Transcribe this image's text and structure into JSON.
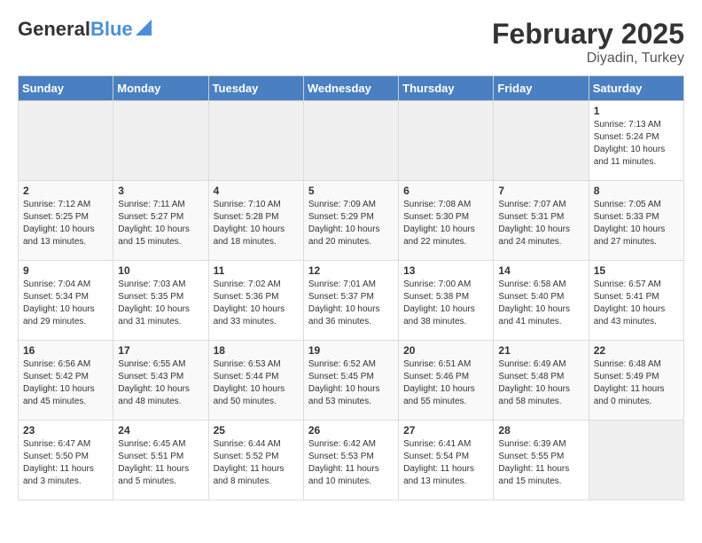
{
  "header": {
    "logo_line1": "General",
    "logo_line2": "Blue",
    "title": "February 2025",
    "subtitle": "Diyadin, Turkey"
  },
  "days_of_week": [
    "Sunday",
    "Monday",
    "Tuesday",
    "Wednesday",
    "Thursday",
    "Friday",
    "Saturday"
  ],
  "weeks": [
    [
      {
        "day": "",
        "info": ""
      },
      {
        "day": "",
        "info": ""
      },
      {
        "day": "",
        "info": ""
      },
      {
        "day": "",
        "info": ""
      },
      {
        "day": "",
        "info": ""
      },
      {
        "day": "",
        "info": ""
      },
      {
        "day": "1",
        "info": "Sunrise: 7:13 AM\nSunset: 5:24 PM\nDaylight: 10 hours\nand 11 minutes."
      }
    ],
    [
      {
        "day": "2",
        "info": "Sunrise: 7:12 AM\nSunset: 5:25 PM\nDaylight: 10 hours\nand 13 minutes."
      },
      {
        "day": "3",
        "info": "Sunrise: 7:11 AM\nSunset: 5:27 PM\nDaylight: 10 hours\nand 15 minutes."
      },
      {
        "day": "4",
        "info": "Sunrise: 7:10 AM\nSunset: 5:28 PM\nDaylight: 10 hours\nand 18 minutes."
      },
      {
        "day": "5",
        "info": "Sunrise: 7:09 AM\nSunset: 5:29 PM\nDaylight: 10 hours\nand 20 minutes."
      },
      {
        "day": "6",
        "info": "Sunrise: 7:08 AM\nSunset: 5:30 PM\nDaylight: 10 hours\nand 22 minutes."
      },
      {
        "day": "7",
        "info": "Sunrise: 7:07 AM\nSunset: 5:31 PM\nDaylight: 10 hours\nand 24 minutes."
      },
      {
        "day": "8",
        "info": "Sunrise: 7:05 AM\nSunset: 5:33 PM\nDaylight: 10 hours\nand 27 minutes."
      }
    ],
    [
      {
        "day": "9",
        "info": "Sunrise: 7:04 AM\nSunset: 5:34 PM\nDaylight: 10 hours\nand 29 minutes."
      },
      {
        "day": "10",
        "info": "Sunrise: 7:03 AM\nSunset: 5:35 PM\nDaylight: 10 hours\nand 31 minutes."
      },
      {
        "day": "11",
        "info": "Sunrise: 7:02 AM\nSunset: 5:36 PM\nDaylight: 10 hours\nand 33 minutes."
      },
      {
        "day": "12",
        "info": "Sunrise: 7:01 AM\nSunset: 5:37 PM\nDaylight: 10 hours\nand 36 minutes."
      },
      {
        "day": "13",
        "info": "Sunrise: 7:00 AM\nSunset: 5:38 PM\nDaylight: 10 hours\nand 38 minutes."
      },
      {
        "day": "14",
        "info": "Sunrise: 6:58 AM\nSunset: 5:40 PM\nDaylight: 10 hours\nand 41 minutes."
      },
      {
        "day": "15",
        "info": "Sunrise: 6:57 AM\nSunset: 5:41 PM\nDaylight: 10 hours\nand 43 minutes."
      }
    ],
    [
      {
        "day": "16",
        "info": "Sunrise: 6:56 AM\nSunset: 5:42 PM\nDaylight: 10 hours\nand 45 minutes."
      },
      {
        "day": "17",
        "info": "Sunrise: 6:55 AM\nSunset: 5:43 PM\nDaylight: 10 hours\nand 48 minutes."
      },
      {
        "day": "18",
        "info": "Sunrise: 6:53 AM\nSunset: 5:44 PM\nDaylight: 10 hours\nand 50 minutes."
      },
      {
        "day": "19",
        "info": "Sunrise: 6:52 AM\nSunset: 5:45 PM\nDaylight: 10 hours\nand 53 minutes."
      },
      {
        "day": "20",
        "info": "Sunrise: 6:51 AM\nSunset: 5:46 PM\nDaylight: 10 hours\nand 55 minutes."
      },
      {
        "day": "21",
        "info": "Sunrise: 6:49 AM\nSunset: 5:48 PM\nDaylight: 10 hours\nand 58 minutes."
      },
      {
        "day": "22",
        "info": "Sunrise: 6:48 AM\nSunset: 5:49 PM\nDaylight: 11 hours\nand 0 minutes."
      }
    ],
    [
      {
        "day": "23",
        "info": "Sunrise: 6:47 AM\nSunset: 5:50 PM\nDaylight: 11 hours\nand 3 minutes."
      },
      {
        "day": "24",
        "info": "Sunrise: 6:45 AM\nSunset: 5:51 PM\nDaylight: 11 hours\nand 5 minutes."
      },
      {
        "day": "25",
        "info": "Sunrise: 6:44 AM\nSunset: 5:52 PM\nDaylight: 11 hours\nand 8 minutes."
      },
      {
        "day": "26",
        "info": "Sunrise: 6:42 AM\nSunset: 5:53 PM\nDaylight: 11 hours\nand 10 minutes."
      },
      {
        "day": "27",
        "info": "Sunrise: 6:41 AM\nSunset: 5:54 PM\nDaylight: 11 hours\nand 13 minutes."
      },
      {
        "day": "28",
        "info": "Sunrise: 6:39 AM\nSunset: 5:55 PM\nDaylight: 11 hours\nand 15 minutes."
      },
      {
        "day": "",
        "info": ""
      }
    ]
  ]
}
